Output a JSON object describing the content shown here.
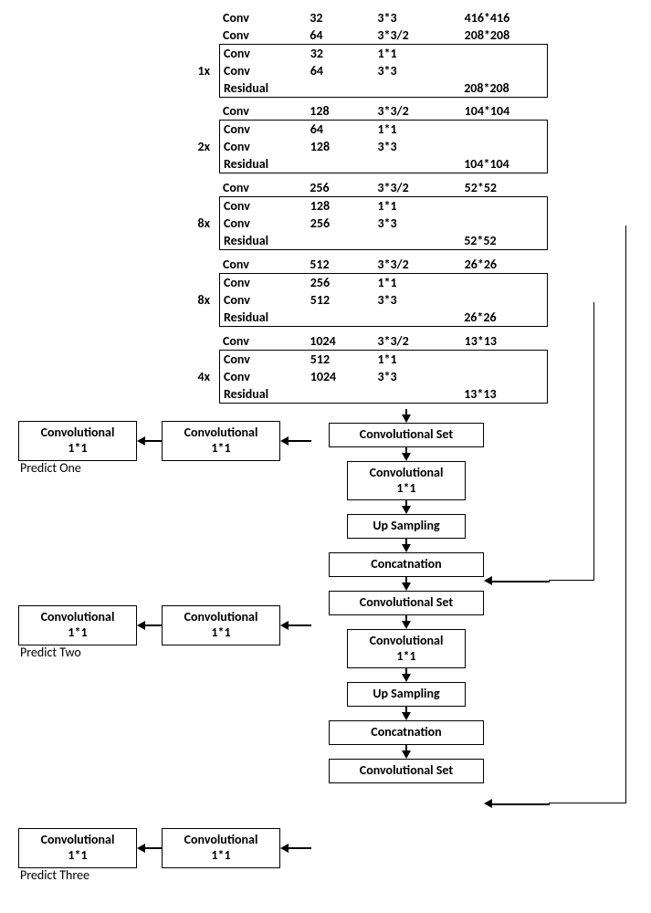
{
  "stages": [
    {
      "mult": "1x",
      "pre": [
        {
          "type": "Conv",
          "filt": "32",
          "kern": "3*3",
          "out": "416*416"
        },
        {
          "type": "Conv",
          "filt": "64",
          "kern": "3*3/2",
          "out": "208*208"
        }
      ],
      "block": [
        {
          "type": "Conv",
          "filt": "32",
          "kern": "1*1",
          "out": ""
        },
        {
          "type": "Conv",
          "filt": "64",
          "kern": "3*3",
          "out": ""
        },
        {
          "type": "Residual",
          "filt": "",
          "kern": "",
          "out": "208*208"
        }
      ]
    },
    {
      "mult": "2x",
      "pre": [
        {
          "type": "Conv",
          "filt": "128",
          "kern": "3*3/2",
          "out": "104*104"
        }
      ],
      "block": [
        {
          "type": "Conv",
          "filt": "64",
          "kern": "1*1",
          "out": ""
        },
        {
          "type": "Conv",
          "filt": "128",
          "kern": "3*3",
          "out": ""
        },
        {
          "type": "Residual",
          "filt": "",
          "kern": "",
          "out": "104*104"
        }
      ]
    },
    {
      "mult": "8x",
      "pre": [
        {
          "type": "Conv",
          "filt": "256",
          "kern": "3*3/2",
          "out": "52*52"
        }
      ],
      "block": [
        {
          "type": "Conv",
          "filt": "128",
          "kern": "1*1",
          "out": ""
        },
        {
          "type": "Conv",
          "filt": "256",
          "kern": "3*3",
          "out": ""
        },
        {
          "type": "Residual",
          "filt": "",
          "kern": "",
          "out": "52*52"
        }
      ]
    },
    {
      "mult": "8x",
      "pre": [
        {
          "type": "Conv",
          "filt": "512",
          "kern": "3*3/2",
          "out": "26*26"
        }
      ],
      "block": [
        {
          "type": "Conv",
          "filt": "256",
          "kern": "1*1",
          "out": ""
        },
        {
          "type": "Conv",
          "filt": "512",
          "kern": "3*3",
          "out": ""
        },
        {
          "type": "Residual",
          "filt": "",
          "kern": "",
          "out": "26*26"
        }
      ]
    },
    {
      "mult": "4x",
      "pre": [
        {
          "type": "Conv",
          "filt": "1024",
          "kern": "3*3/2",
          "out": "13*13"
        }
      ],
      "block": [
        {
          "type": "Conv",
          "filt": "512",
          "kern": "1*1",
          "out": ""
        },
        {
          "type": "Conv",
          "filt": "1024",
          "kern": "3*3",
          "out": ""
        },
        {
          "type": "Residual",
          "filt": "",
          "kern": "",
          "out": "13*13"
        }
      ]
    }
  ],
  "flow": {
    "convset": "Convolutional Set",
    "conv1x1": "Convolutional",
    "conv1x1_sub": "1*1",
    "upsample": "Up Sampling",
    "concat": "Concatnation"
  },
  "predicts": {
    "one": "Predict One",
    "two": "Predict Two",
    "three": "Predict Three"
  }
}
